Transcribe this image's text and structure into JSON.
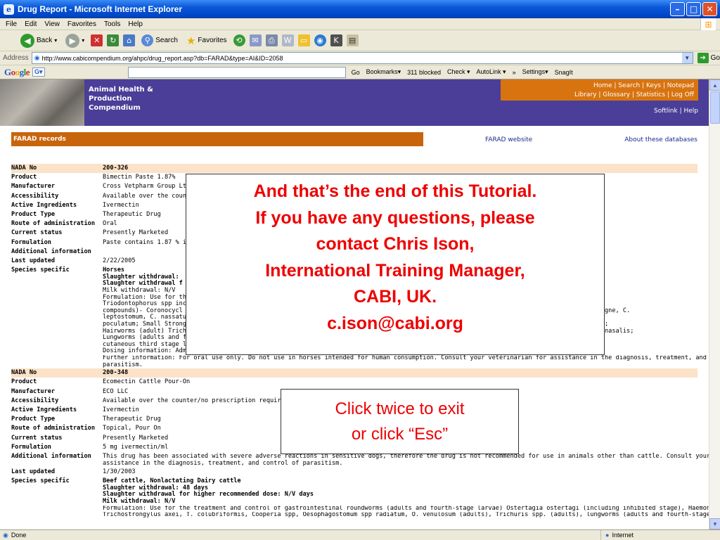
{
  "window": {
    "title": "Drug Report - Microsoft Internet Explorer"
  },
  "menu": [
    "File",
    "Edit",
    "View",
    "Favorites",
    "Tools",
    "Help"
  ],
  "toolbar": {
    "back": "Back",
    "search": "Search",
    "favorites": "Favorites"
  },
  "address": {
    "label": "Address",
    "url": "http://www.cabicompendium.org/ahpc/drug_report.asp?db=FARAD&type=AI&ID=2058",
    "go": "Go"
  },
  "google_bar": {
    "logo": "Google",
    "g": "G",
    "items": [
      "Go",
      "Bookmarks▾",
      "311 blocked",
      "Check ▾",
      "AutoLink ▾",
      "»",
      "Settings▾",
      "SnagIt"
    ]
  },
  "banner": {
    "title": "Animal Health &\nProduction\nCompendium",
    "links_line1": "Home   |   Search   |   Keys   |   Notepad",
    "links_line2": "Library   |   Glossary   |  Statistics  |   Log Off",
    "softlink": "Softlink | Help"
  },
  "section": {
    "title": "FARAD records",
    "farad_website": "FARAD website",
    "about": "About these databases"
  },
  "record1": {
    "nada": "200-326",
    "product": "Bimectin Paste 1.87%",
    "manufacturer": "Cross Vetpharm Group Lt",
    "accessibility": "Available over the counte",
    "active": "Ivermectin",
    "type": "Therapeutic Drug",
    "route": "Oral",
    "status": "Presently Marketed",
    "formulation": "Paste contains 1.87 % ive",
    "additional": "",
    "updated": "2/22/2005",
    "species_lines": [
      "Horses",
      "Slaughter withdrawal:",
      "Slaughter withdrawal f",
      "Milk withdrawal: N/V",
      "Formulation: Use for the                                                                                              ages), S. equinus,",
      "Triodontophorus spp incl                                                                                              nzimidazole class",
      "compounds)- Coronocycl                                                                                              spp, including C. insigne, C.",
      "leptostomum, C. nassatu                                                                                              us, and Petrovinema",
      "poculatum; Small Strongy                                                                                              ) Parascaris equorum;",
      "Hairworms (adult) Tricho                                                                                              intestinalis and G. nasalis;",
      "Lungworms (adults and fo                                                                                              ia and Draschia spp,",
      "cutaneous third stage larv",
      "Dosing information: Administer 200 mcg/kg (91 mcg/lb) bwt.",
      "Further information: For oral use only. Do not use in horses intended for human consumption. Consult your veterinarian for assistance in the diagnosis, treatment, and control of",
      "parasitism."
    ]
  },
  "record2": {
    "nada": "200-348",
    "product": "Ecomectin Cattle Pour-On",
    "manufacturer": "ECO LLC",
    "accessibility": "Available over the counter/no prescription required",
    "active": "Ivermectin",
    "type": "Therapeutic Drug",
    "route": "Topical, Pour On",
    "status": "Presently Marketed",
    "formulation": "5 mg ivermectin/ml",
    "additional_1": "This drug has been associated with severe adverse reactions in sensitive dogs, therefore the drug is not recommended for use in animals other than cattle. Consult your veterinarian for",
    "additional_2": "assistance in the diagnosis, treatment, and control of parasitism.",
    "updated": "1/30/2003",
    "species_lines": [
      "Beef cattle, Nonlactating Dairy cattle",
      "Slaughter withdrawal: 48 days",
      "Slaughter withdrawal for higher recommended dose: N/V days",
      "Milk withdrawal: N/V",
      "Formulation: Use for the treatment and control of gastrointestinal roundworms (adults and fourth-stage larvae) Ostertagia ostertagi (including inhibited stage), Haemonchus placei,",
      "Trichostrongylus axei, T. colubriformis, Cooperia spp, Oesophagostomum spp radiatum, O. venulosum (adults), Trichuris spp. (adults), lungworms (adults and fourth-stage larvae)"
    ]
  },
  "labels": {
    "nada": "NADA No",
    "product": "Product",
    "manufacturer": "Manufacturer",
    "accessibility": "Accessibility",
    "active": "Active Ingredients",
    "type": "Product Type",
    "route": "Route of administration",
    "status": "Current status",
    "formulation": "Formulation",
    "additional": "Additional information",
    "updated": "Last updated",
    "species": "Species specific"
  },
  "overlay_main": "And that’s the  end of this Tutorial.\nIf you have any questions, please\ncontact Chris Ison,\nInternational Training Manager,\nCABI, UK.\nc.ison@cabi.org",
  "overlay_exit": "Click twice to exit\nor click “Esc”",
  "status": {
    "left": "Done",
    "zone": "Internet"
  }
}
